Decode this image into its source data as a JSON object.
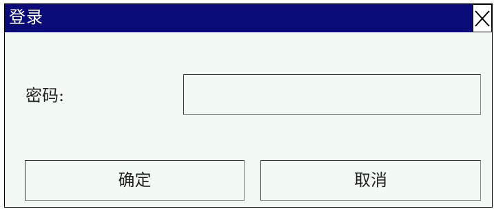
{
  "window": {
    "title": "登录"
  },
  "titlebar": {
    "close_icon": "close-icon"
  },
  "form": {
    "password_label": "密码:",
    "password_value": ""
  },
  "buttons": {
    "ok_label": "确定",
    "cancel_label": "取消"
  },
  "colors": {
    "titlebar_bg": "#0a0a78",
    "title_text": "#ffffff",
    "dialog_bg": "#f3f9f3"
  }
}
